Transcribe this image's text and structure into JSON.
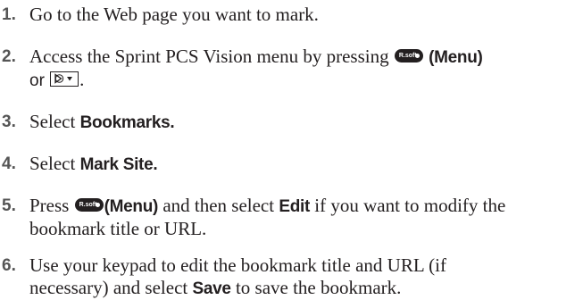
{
  "steps": [
    {
      "num": "1.",
      "text": "Go to the Web page you want to mark."
    },
    {
      "num": "2.",
      "text_a": "Access the Sprint PCS Vision menu by pressing",
      "softkey_label": "R.soft",
      "menu_a": "(Menu)",
      "text_or": "or",
      "period": "."
    },
    {
      "num": "3.",
      "text_a": "Select",
      "bookmarks": "Bookmarks."
    },
    {
      "num": "4.",
      "text_a": "Select",
      "mark_site": "Mark Site."
    },
    {
      "num": "5.",
      "text_a": "Press",
      "softkey_label": "R.soft",
      "menu_a": "(Menu)",
      "text_b": "and then select",
      "edit": "Edit",
      "text_c": "if you want to modify the",
      "text_d": "bookmark title or URL."
    },
    {
      "num": "6.",
      "text_a": "Use your keypad to edit the bookmark title and URL (if",
      "text_b": "necessary) and select",
      "save": "Save",
      "text_c": "to save the bookmark."
    }
  ],
  "icons": {
    "softkey": "right-softkey-icon",
    "nav": "navigation-key-icon"
  }
}
